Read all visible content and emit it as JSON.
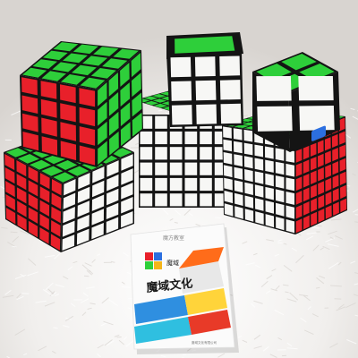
{
  "photo": {
    "subject": "MoYu Rubik's cube collection",
    "background_color": "#f4f2f0",
    "fur_texture": "white faux fur",
    "cube_body_color": "#141414"
  },
  "sticker_colors": {
    "white": "#f7f7f5",
    "green": "#2ecf3a",
    "red": "#e8202a",
    "orange": "#ff6a1a",
    "yellow": "#f4e14a",
    "blue": "#2c6fe0"
  },
  "cubes": [
    {
      "id": "4x4",
      "size": 4
    },
    {
      "id": "3x3",
      "size": 3
    },
    {
      "id": "2x2",
      "size": 2
    },
    {
      "id": "5x5",
      "size": 5
    },
    {
      "id": "6x6",
      "size": 6
    },
    {
      "id": "7x7",
      "size": 7
    }
  ],
  "booklet": {
    "brand_cn": "魔域文化",
    "logo_text": "魔域",
    "tag_text": "魔方教室",
    "footer_text": "魔域文化有限公司"
  }
}
